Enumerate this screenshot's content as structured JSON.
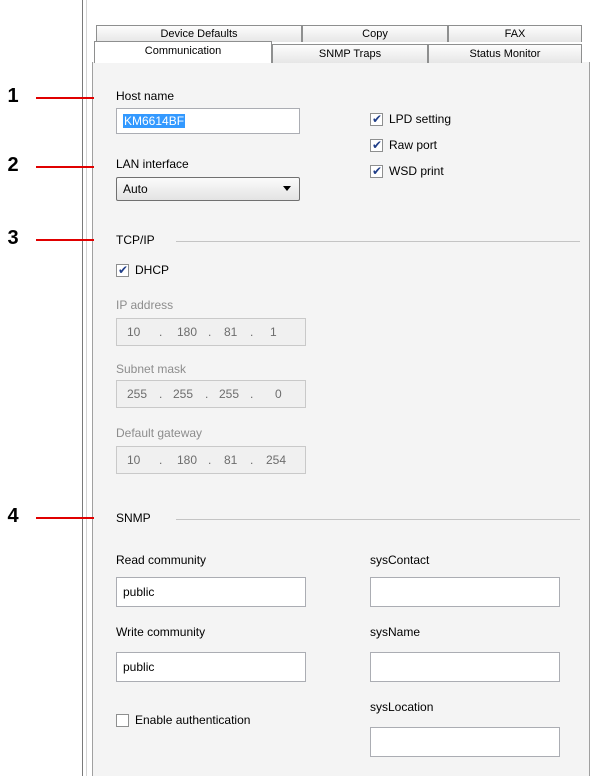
{
  "tabs_row1": [
    "Device Defaults",
    "Copy",
    "FAX"
  ],
  "tabs_row2": [
    "Communication",
    "SNMP Traps",
    "Status Monitor"
  ],
  "callouts": [
    "1",
    "2",
    "3",
    "4"
  ],
  "host_name": {
    "label": "Host name",
    "value": "KM6614BF"
  },
  "lan_interface": {
    "label": "LAN interface",
    "value": "Auto"
  },
  "services": {
    "lpd": {
      "label": "LPD setting",
      "checked": true
    },
    "raw": {
      "label": "Raw port",
      "checked": true
    },
    "wsd": {
      "label": "WSD print",
      "checked": true
    }
  },
  "tcpip": {
    "title": "TCP/IP",
    "dhcp": {
      "label": "DHCP",
      "checked": true
    },
    "ip_label": "IP address",
    "ip": [
      "10",
      "180",
      "81",
      "1"
    ],
    "subnet_label": "Subnet mask",
    "subnet": [
      "255",
      "255",
      "255",
      "0"
    ],
    "gateway_label": "Default gateway",
    "gateway": [
      "10",
      "180",
      "81",
      "254"
    ]
  },
  "snmp": {
    "title": "SNMP",
    "read_label": "Read community",
    "read_value": "public",
    "write_label": "Write community",
    "write_value": "public",
    "enable_auth_label": "Enable authentication",
    "enable_auth_checked": false,
    "syscontact_label": "sysContact",
    "syscontact_value": "",
    "sysname_label": "sysName",
    "sysname_value": "",
    "syslocation_label": "sysLocation",
    "syslocation_value": ""
  },
  "ip_dot": "."
}
